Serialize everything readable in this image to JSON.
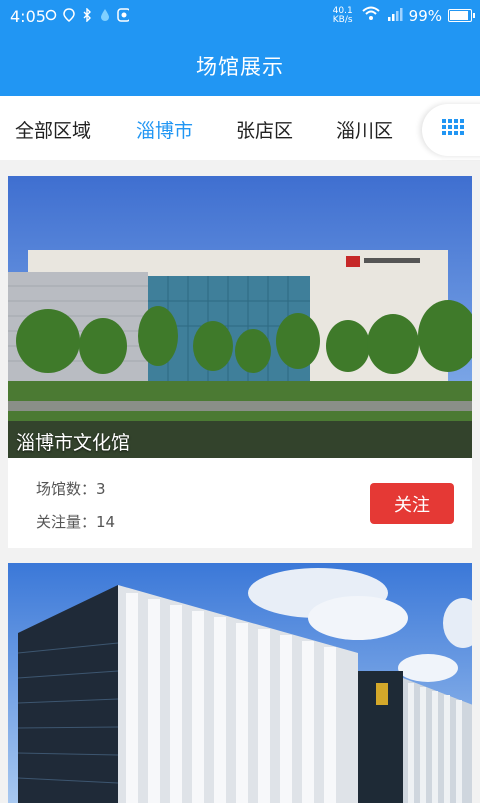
{
  "status": {
    "time": "4:05",
    "net_speed_value": "40.1",
    "net_speed_unit": "KB/s",
    "battery": "99%",
    "battery_level": 0.99
  },
  "header": {
    "title": "场馆展示"
  },
  "tabs": [
    {
      "label": "全部区域",
      "active": false
    },
    {
      "label": "淄博市",
      "active": true
    },
    {
      "label": "张店区",
      "active": false
    },
    {
      "label": "淄川区",
      "active": false
    }
  ],
  "venues": [
    {
      "name": "淄博市文化馆",
      "count_label": "场馆数：",
      "count": "3",
      "follow_count_label": "关注量：",
      "follow_count": "14",
      "follow_button": "关注"
    },
    {}
  ],
  "colors": {
    "primary": "#2196f3",
    "follow_button": "#e53935",
    "active_tab": "#2196f3"
  },
  "icons": [
    "signal-icon",
    "wifi-icon",
    "battery-icon",
    "grid-menu-icon"
  ]
}
